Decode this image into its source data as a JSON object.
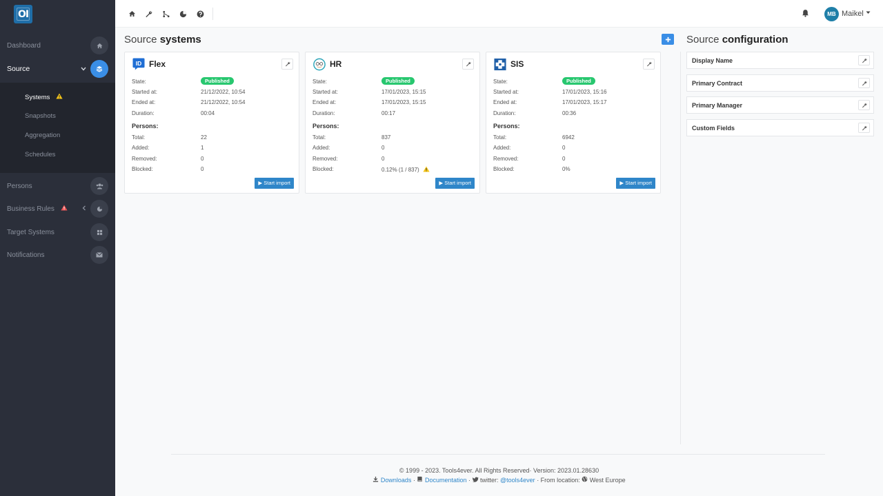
{
  "app": {
    "logo_text": "OI"
  },
  "sidebar": {
    "items": [
      {
        "label": "Dashboard"
      },
      {
        "label": "Source"
      },
      {
        "label": "Persons"
      },
      {
        "label": "Business Rules"
      },
      {
        "label": "Target Systems"
      },
      {
        "label": "Notifications"
      }
    ],
    "submenu": [
      {
        "label": "Systems"
      },
      {
        "label": "Snapshots"
      },
      {
        "label": "Aggregation"
      },
      {
        "label": "Schedules"
      }
    ]
  },
  "topbar": {
    "user_initials": "MB",
    "user_name": "Maikel"
  },
  "source_systems": {
    "title_prefix": "Source",
    "title_bold": "systems",
    "cards": [
      {
        "name": "Flex",
        "labels": {
          "state": "State:",
          "started": "Started at:",
          "ended": "Ended at:",
          "duration": "Duration:",
          "persons": "Persons:",
          "total": "Total:",
          "added": "Added:",
          "removed": "Removed:",
          "blocked": "Blocked:"
        },
        "state": "Published",
        "started_at": "21/12/2022, 10:54",
        "ended_at": "21/12/2022, 10:54",
        "duration": "00:04",
        "total": "22",
        "added": "1",
        "removed": "0",
        "blocked": "0",
        "button": "Start import"
      },
      {
        "name": "HR",
        "labels": {
          "state": "State:",
          "started": "Started at:",
          "ended": "Ended at:",
          "duration": "Duration:",
          "persons": "Persons:",
          "total": "Total:",
          "added": "Added:",
          "removed": "Removed:",
          "blocked": "Blocked:"
        },
        "state": "Published",
        "started_at": "17/01/2023, 15:15",
        "ended_at": "17/01/2023, 15:15",
        "duration": "00:17",
        "total": "837",
        "added": "0",
        "removed": "0",
        "blocked": "0.12% (1 / 837)",
        "button": "Start import"
      },
      {
        "name": "SIS",
        "labels": {
          "state": "State:",
          "started": "Started at:",
          "ended": "Ended at:",
          "duration": "Duration:",
          "persons": "Persons:",
          "total": "Total:",
          "added": "Added:",
          "removed": "Removed:",
          "blocked": "Blocked:"
        },
        "state": "Published",
        "started_at": "17/01/2023, 15:16",
        "ended_at": "17/01/2023, 15:17",
        "duration": "00:36",
        "total": "6942",
        "added": "0",
        "removed": "0",
        "blocked": "0%",
        "button": "Start import"
      }
    ]
  },
  "source_configuration": {
    "title_prefix": "Source",
    "title_bold": "configuration",
    "items": [
      {
        "label": "Display Name"
      },
      {
        "label": "Primary Contract"
      },
      {
        "label": "Primary Manager"
      },
      {
        "label": "Custom Fields"
      }
    ]
  },
  "footer": {
    "line1": "© 1999 - 2023. Tools4ever. All Rights Reserved· Version: 2023.01.28630",
    "downloads": "Downloads",
    "sep1": " · ",
    "documentation": "Documentation",
    "sep2": " · ",
    "twitter_label": " twitter: ",
    "twitter_handle": "@tools4ever",
    "location_text": " · From location: ",
    "location": " West Europe"
  },
  "colors": {
    "sidebar_bg": "#2b2f3a",
    "accent": "#3a8ee6",
    "published": "#28c76f",
    "import_button": "#2f86c9",
    "warning_yellow": "#f5c518",
    "warning_red": "#ea5455"
  }
}
